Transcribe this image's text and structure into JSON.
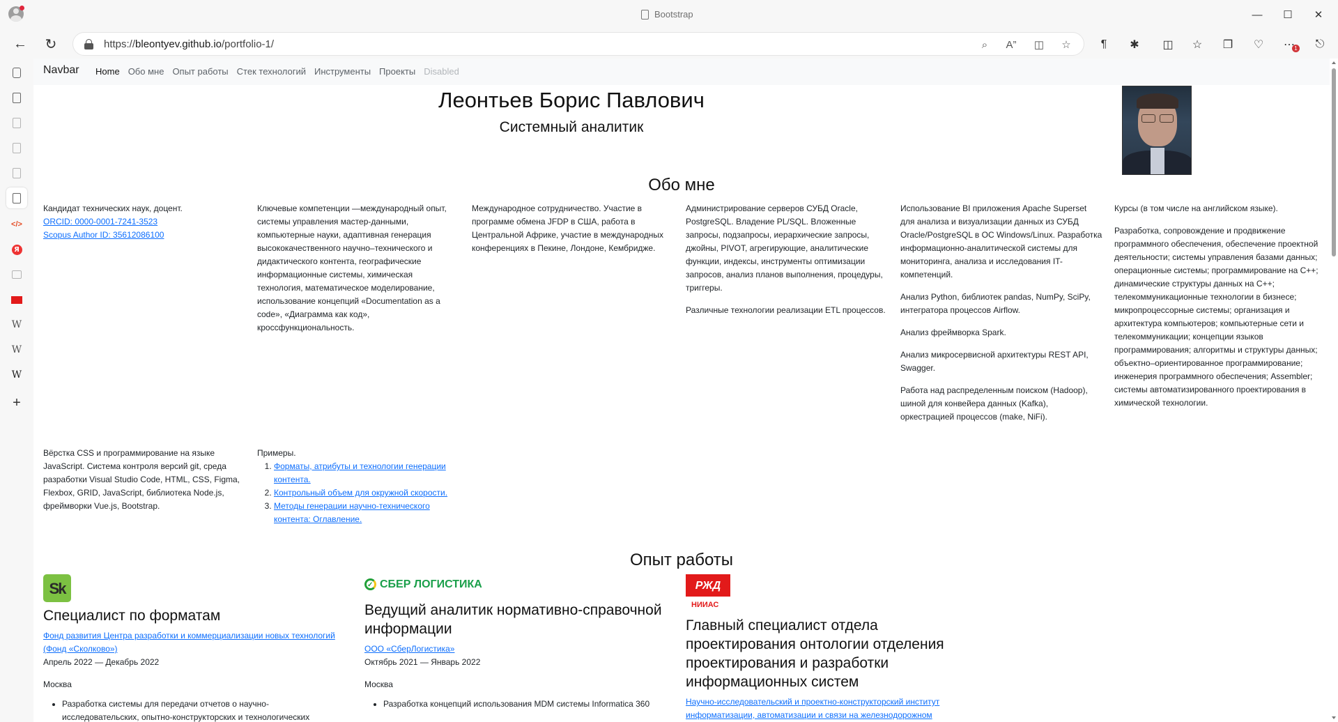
{
  "browser": {
    "tab_title": "Bootstrap",
    "url_prefix": "https://",
    "url_host": "bleontyev.github.io",
    "url_path": "/portfolio-1/",
    "badge_count": "1"
  },
  "navbar": {
    "brand": "Navbar",
    "links": [
      "Home",
      "Обо мне",
      "Опыт работы",
      "Стек технологий",
      "Инструменты",
      "Проекты",
      "Disabled"
    ]
  },
  "hero": {
    "name": "Леонтьев Борис Павлович",
    "role": "Системный аналитик"
  },
  "about": {
    "title": "Обо мне",
    "col1": {
      "text": "Кандидат технических наук, доцент.",
      "orcid": "ORCID: 0000-0001-7241-3523",
      "scopus": "Scopus Author ID: 35612086100"
    },
    "col2": "Ключевые компетенции —международный опыт, системы управления мастер-данными, компьютерные науки, адаптивная генерация высококачественного научно–технического и дидактического контента, географические информационные системы, химическая технология, математическое моделирование, использование концепций «Documentation as a code», «Диаграмма как код», кроссфункциональность.",
    "col3": "Международное сотрудничество. Участие в программе обмена JFDP в США, работа в Центральной Африке, участие в международных конференциях в Пекине, Лондоне, Кембридже.",
    "col4": [
      "Администрирование серверов СУБД Oracle, PostgreSQL. Владение PL/SQL. Вложенные запросы, подзапросы, иерархические запросы, джойны, PIVOT, агрегирующие, аналитические функции, индексы, инструменты оптимизации запросов, анализ планов выполнения, процедуры, триггеры.",
      "Различные технологии реализации ETL процессов."
    ],
    "col5": [
      "Использование BI приложения Apache Superset для анализа и визуализации данных из СУБД Oracle/PostgreSQL в ОС Windows/Linux. Разработка информационно-аналитической системы для мониторинга, анализа и исследования IT-компетенций.",
      "Анализ Python, библиотек pandas, NumPy, SciPy, интегратора процессов Airflow.",
      "Анализ фреймворка Spark.",
      "Анализ микросервисной архитектуры REST API, Swagger.",
      "Работа над распределенным поиском (Hadoop), шиной для конвейера данных (Kafka), оркестрацией процессов (make, NiFi)."
    ],
    "col6": [
      "Курсы (в том числе на английском языке).",
      "Разработка, сопровождение и продвижение программного обеспечения, обеспечение проектной деятельности; системы управления базами данных; операционные системы; программирование на C++; динамические структуры данных на C++; телекоммуникационные технологии в бизнесе; микропроцессорные системы; организация и архитектура компьютеров; компьютерные сети и телекоммуникации; концепции языков программирования; алгоритмы и структуры данных; объектно–ориентированное программирование; инженерия программного обеспечения; Assembler; системы автоматизированного проектирования в химической технологии."
    ],
    "col7": "Вёрстка CSS и программирование на языке JavaScript. Система контроля версий git, среда разработки Visual Studio Code, HTML, CSS, Figma, Flexbox, GRID, JavaScript, библиотека Node.js, фреймворки Vue.js, Bootstrap.",
    "col8": {
      "label": "Примеры.",
      "items": [
        "Форматы, атрибуты и технологии генерации контента.",
        "Контрольный объем для окружной скорости.",
        "Методы генерации научно-технического контента: Оглавление."
      ]
    }
  },
  "experience": {
    "title": "Опыт работы",
    "jobs": [
      {
        "logo_text": "Sk",
        "title": "Специалист по форматам",
        "org": "Фонд развития Центра разработки и коммерциализации новых технологий (Фонд «Сколково»)",
        "period": "Апрель 2022 — Декабрь 2022",
        "place": "Москва",
        "duty": "Разработка системы для передачи отчетов о научно-исследовательских, опытно-конструкторских и технологических"
      },
      {
        "logo_text": "СБЕР ЛОГИСТИКА",
        "title": "Ведущий аналитик нормативно-справочной информации",
        "org": "ООО «СберЛогистика»",
        "period": "Октябрь 2021 — Январь 2022",
        "place": "Москва",
        "duty": "Разработка концепций использования MDM системы Informatica 360"
      },
      {
        "logo_text": "РЖД",
        "logo_sub": "НИИАС",
        "title": "Главный специалист отдела проектирования онтологии отделения проектирования и разработки информационных систем",
        "org": "Научно-исследовательский и проектно-конструкторский институт информатизации, автоматизации и связи на железнодорожном"
      }
    ]
  }
}
